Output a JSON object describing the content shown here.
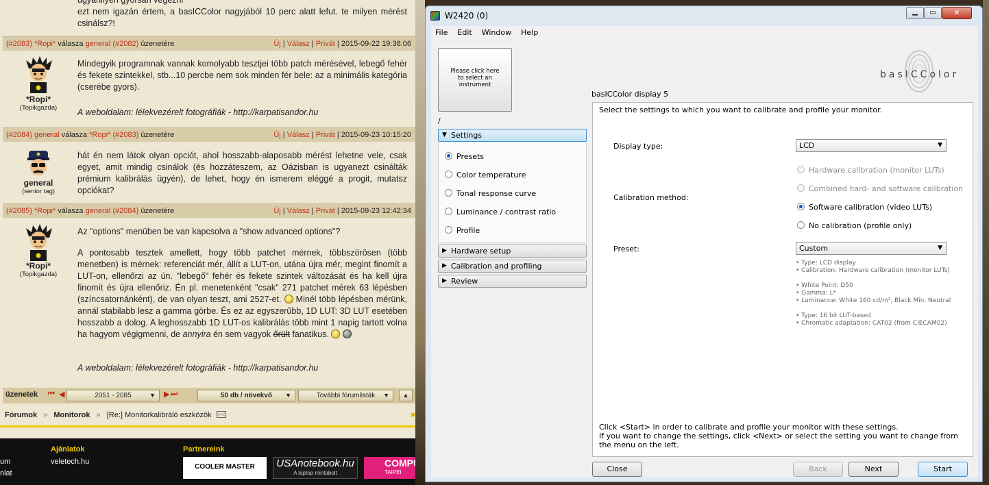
{
  "forum": {
    "top_text_1": "ugyanilyen gyorsan végezni",
    "top_text_2": "ezt nem igazán értem, a basICColor nagyjából 10 perc alatt lefut. te milyen mérést csinálsz?!",
    "posts": [
      {
        "num": "(#2083)",
        "author": "*Ropi*",
        "reply_word": "válasza",
        "reply_to": "general",
        "reply_num": "(#2082)",
        "suffix": "üzenetére",
        "new": "Új",
        "reply": "Válasz",
        "private": "Privát",
        "date": "2015-09-22 19:38:06",
        "user": "*Ropi*",
        "rank": "(Topikgazda)",
        "text": "Mindegyik programnak vannak komolyabb tesztjei több patch mérésével, lebegő fehér és fekete szintekkel, stb...10 percbe nem sok minden fér bele: az a minimális kategória (cserébe gyors).",
        "signature": "A weboldalam: lélekvezérelt fotográfiák - http://karpatisandor.hu"
      },
      {
        "num": "(#2084)",
        "author": "general",
        "reply_word": "válasza",
        "reply_to": "*Ropi*",
        "reply_num": "(#2083)",
        "suffix": "üzenetére",
        "new": "Új",
        "reply": "Válasz",
        "private": "Privát",
        "date": "2015-09-23 10:15:20",
        "user": "general",
        "rank": "(senior tag)",
        "text": "hát én nem látok olyan opciót, ahol hosszabb-alaposabb mérést lehetne vele, csak egyet, amit mindig csinálok (és hozzáteszem, az Oázisban is ugyanezt csinálták prémium kalibrálás ügyén), de lehet, hogy én ismerem eléggé a progit, mutatsz opciókat?"
      },
      {
        "num": "(#2085)",
        "author": "*Ropi*",
        "reply_word": "válasza",
        "reply_to": "general",
        "reply_num": "(#2084)",
        "suffix": "üzenetére",
        "new": "Új",
        "reply": "Válasz",
        "private": "Privát",
        "date": "2015-09-23 12:42:34",
        "user": "*Ropi*",
        "rank": "(Topikgazda)",
        "text_p1": "Az \"options\" menüben be van kapcsolva a \"show advanced options\"?",
        "text_p2_a": "A pontosabb tesztek amellett, hogy több patchet mérnek, többszörösen (több menetben) is mérnek: referenciát mér, állít a LUT-on, utána újra mér, megint finomít a LUT-on, ellenőrzi az ún. \"lebegő\" fehér és fekete szintek változását és ha kell újra finomít és újra ellenőriz. Én pl. menetenként \"csak\" 271 patchet mérek 63 lépésben (színcsatornánként), de van olyan teszt, ami 2527-et.",
        "text_p2_b": "Minél több lépésben mérünk, annál stabilabb lesz a gamma görbe. És ez az egyszerűbb, 1D LUT: 3D LUT esetében hosszabb a dolog. A leghosszabb 1D LUT-os kalibrálás több mint 1 napig tartott volna ha hagyom végigmenni, de",
        "text_p2_em": "annyira",
        "text_p2_c": "én sem vagyok",
        "text_p2_strike": "őrült",
        "text_p2_d": "fanatikus.",
        "signature": "A weboldalam: lélekvezérelt fotográfiák - http://karpatisandor.hu"
      }
    ],
    "pager": {
      "label": "üzenetek",
      "range": "2051 - 2085",
      "perpage": "50 db / növekvő",
      "more": "További fórumlisták"
    },
    "breadcrumb": {
      "forums": "Fórumok",
      "sep": "»",
      "monitors": "Monitorok",
      "topic": "[Re:] Monitorkalibráló eszközök"
    },
    "footer": {
      "col1_a": "um",
      "col1_b": "nlat",
      "offers": "Ajánlatok",
      "offer_link": "veletech.hu",
      "partners": "Partnereink",
      "partner1": "COOLER MASTER",
      "partner2": "USAnotebook.hu",
      "partner2_sub": "A laptop mintabolt",
      "partner3": "COMPU",
      "partner3_sub": "TAIPEI"
    }
  },
  "app": {
    "title": "W2420 (0)",
    "menu": [
      "File",
      "Edit",
      "Window",
      "Help"
    ],
    "instrument": "Please click here to select an instrument",
    "slash": "/",
    "brand": "basICColor",
    "product": "basICColor display 5",
    "nav": {
      "settings": "Settings",
      "items": [
        "Presets",
        "Color temperature",
        "Tonal response curve",
        "Luminance / contrast ratio",
        "Profile"
      ],
      "hardware": "Hardware setup",
      "calibration": "Calibration and profiling",
      "review": "Review"
    },
    "instructions": "Select the settings to which you want to calibrate and profile your monitor.",
    "display_type_label": "Display type:",
    "display_type_value": "LCD",
    "cal_method_label": "Calibration method:",
    "cal_options": [
      "Hardware calibration (monitor LUTs)",
      "Combined hard- and software calibration",
      "Software calibration (video LUTs)",
      "No calibration (profile only)"
    ],
    "preset_label": "Preset:",
    "preset_value": "Custom",
    "info_lines": [
      "• Type: LCD display",
      "• Calibration: Hardware calibration (monitor LUTs)",
      "• White Point: D50",
      "• Gamma: L*",
      "• Luminance: White 160 cd/m², Black Min. Neutral",
      "• Type: 16 bit LUT-based",
      "• Chromatic adaptation: CAT02 (from CIECAM02)"
    ],
    "footer_text_1": "Click <Start> in order to calibrate and profile your monitor with these settings.",
    "footer_text_2": "If you want to change the settings, click <Next> or select the setting you want to change from the menu on the left.",
    "buttons": {
      "close": "Close",
      "back": "Back",
      "next": "Next",
      "start": "Start"
    }
  }
}
